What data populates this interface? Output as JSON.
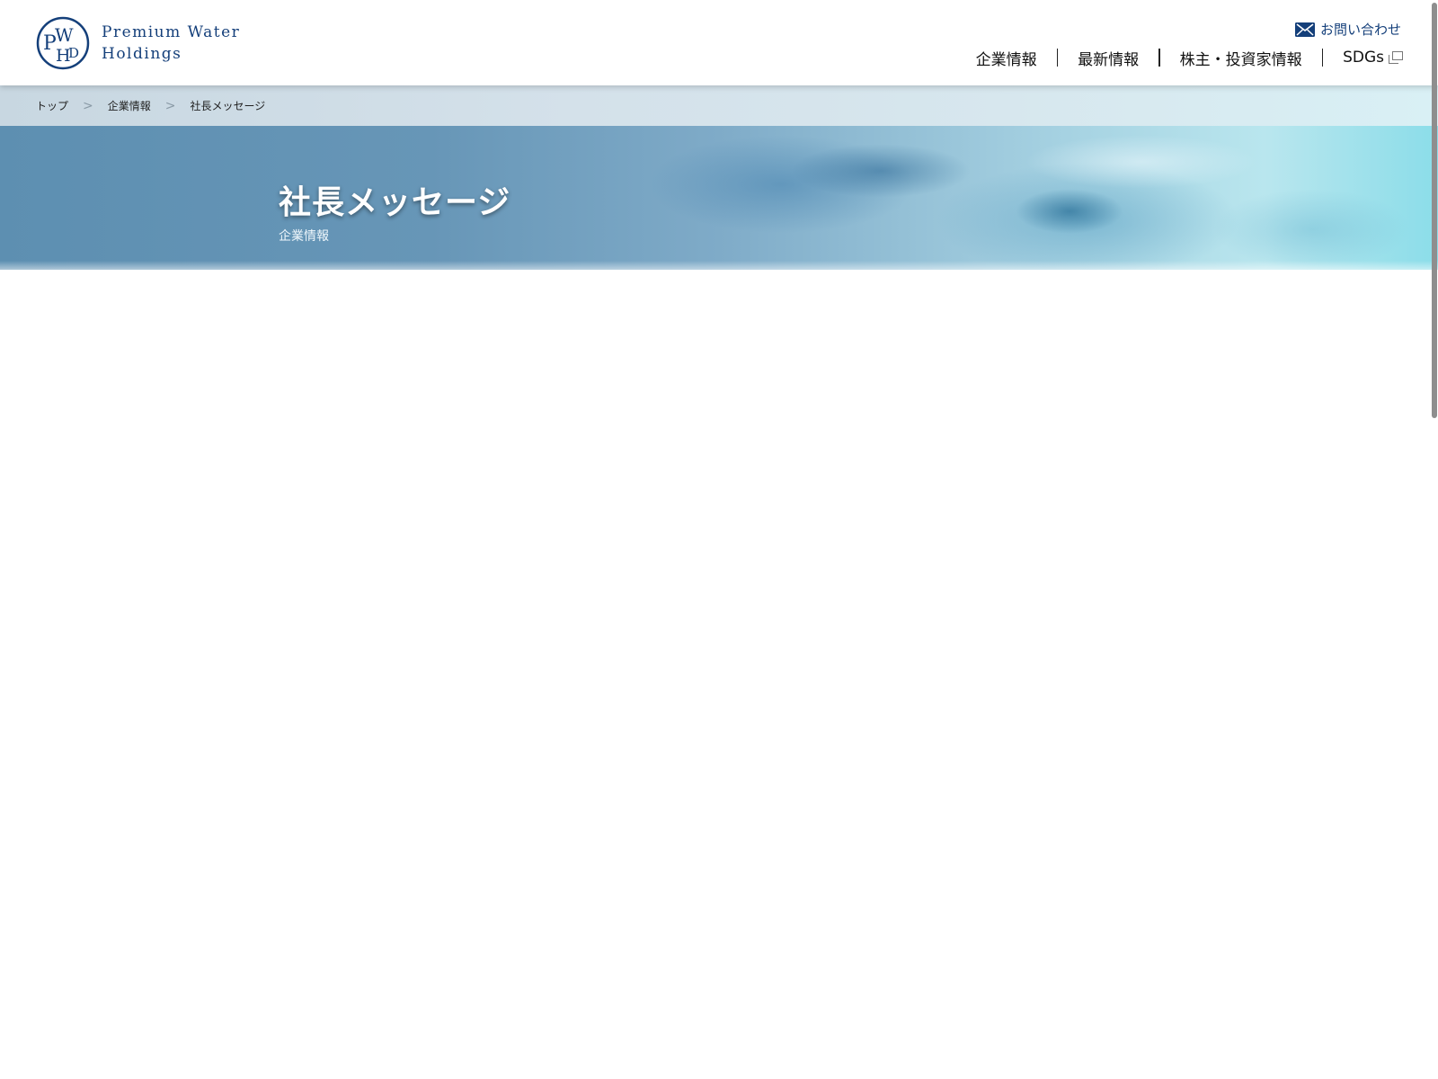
{
  "header": {
    "logo": {
      "monogram": "PWHD",
      "line1": "Premium Water",
      "line2": "Holdings",
      "color": "#143f7a"
    },
    "contact": {
      "label": "お問い合わせ",
      "icon": "mail-icon"
    },
    "nav": [
      {
        "label": "企業情報"
      },
      {
        "label": "最新情報"
      },
      {
        "label": "株主・投資家情報"
      },
      {
        "label": "SDGs",
        "icon": "external-link-icon"
      }
    ]
  },
  "breadcrumb": {
    "items": [
      "トップ",
      "企業情報",
      "社長メッセージ"
    ],
    "separator": ">"
  },
  "hero": {
    "title": "社長メッセージ",
    "subtitle": "企業情報"
  },
  "colors": {
    "brand": "#143f7a",
    "hero_left": "#5d8fb1",
    "hero_right": "#8bdde9"
  }
}
